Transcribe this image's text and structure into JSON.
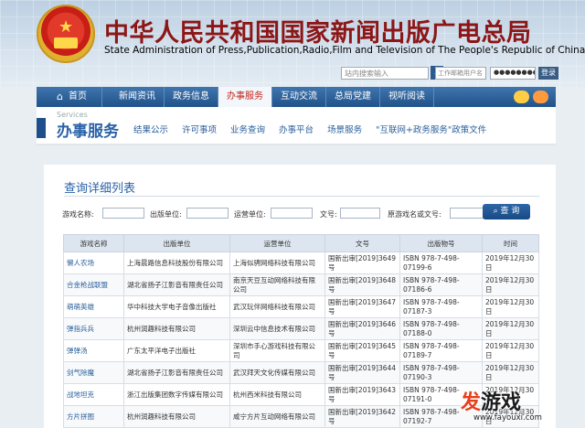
{
  "header": {
    "title_cn": "中华人民共和国国家新闻出版广电总局",
    "title_en": "State Administration of Press,Publication,Radio,Film and Television of The People's Republic of China",
    "site_search_placeholder": "站内搜索输入",
    "search_icon": "search-icon",
    "email_user_placeholder": "工作邮箱用户名",
    "email_password_value": "●●●●●●●●●",
    "login_label": "登录"
  },
  "nav": {
    "items": [
      {
        "label": "首页",
        "icon": "home-icon"
      },
      {
        "label": "新闻资讯"
      },
      {
        "label": "政务信息"
      },
      {
        "label": "办事服务",
        "active": true
      },
      {
        "label": "互动交流"
      },
      {
        "label": "总局党建"
      },
      {
        "label": "视听阅读"
      }
    ],
    "social_icons": [
      "wechat-icon",
      "weibo-icon"
    ],
    "active_color": "#c0261c"
  },
  "subnav": {
    "en": "Services",
    "cn": "办事服务",
    "links": [
      "结果公示",
      "许可事项",
      "业务查询",
      "办事平台",
      "场景服务",
      "\"互联网+政务服务\"政策文件"
    ]
  },
  "main": {
    "title": "查询详细列表",
    "filters": {
      "game_name": "游戏名称:",
      "publisher": "出版单位:",
      "operator": "运营单位:",
      "doc_no": "文号:",
      "isbn_or_doc": "原游戏名或文号:",
      "query_label": "查 询"
    },
    "table": {
      "headers": [
        "游戏名称",
        "出版单位",
        "运营单位",
        "文号",
        "出版物号",
        "时间"
      ],
      "rows": [
        [
          "懒人农场",
          "上海晨路信息科技股份有限公司",
          "上海似骋网络科技有限公司",
          "国新出审[2019]3649号",
          "ISBN 978-7-498-07199-6",
          "2019年12月30日"
        ],
        [
          "合金枪战联盟",
          "湖北省扬子江影音有限责任公司",
          "南京天豆互动网络科技有限公司",
          "国新出审[2019]3648号",
          "ISBN 978-7-498-07186-6",
          "2019年12月30日"
        ],
        [
          "萌萌英雄",
          "华中科技大学电子音像出版社",
          "武汉玩伴网络科技有限公司",
          "国新出审[2019]3647号",
          "ISBN 978-7-498-07187-3",
          "2019年12月30日"
        ],
        [
          "弹指兵兵",
          "杭州润趣科技有限公司",
          "深圳云中信息技术有限公司",
          "国新出审[2019]3646号",
          "ISBN 978-7-498-07188-0",
          "2019年12月30日"
        ],
        [
          "弹弹汤",
          "广东太平洋电子出版社",
          "深圳市手心游戏科技有限公司",
          "国新出审[2019]3645号",
          "ISBN 978-7-498-07189-7",
          "2019年12月30日"
        ],
        [
          "剑气除魔",
          "湖北省扬子江影音有限责任公司",
          "武汉拜天文化传媒有限公司",
          "国新出审[2019]3644号",
          "ISBN 978-7-498-07190-3",
          "2019年12月30日"
        ],
        [
          "战地坦克",
          "浙江出版集团数字传媒有限公司",
          "杭州西米科技有限公司",
          "国新出审[2019]3643号",
          "ISBN 978-7-498-07191-0",
          "2019年12月30日"
        ],
        [
          "方片拼图",
          "杭州润趣科技有限公司",
          "咸宁方片互动网络有限公司",
          "国新出审[2019]3642号",
          "ISBN 978-7-498-07192-7",
          "2019年12月30日"
        ]
      ]
    }
  },
  "watermark": {
    "fa": "发",
    "rest": "游戏",
    "url": "www.fayouxi.com"
  }
}
